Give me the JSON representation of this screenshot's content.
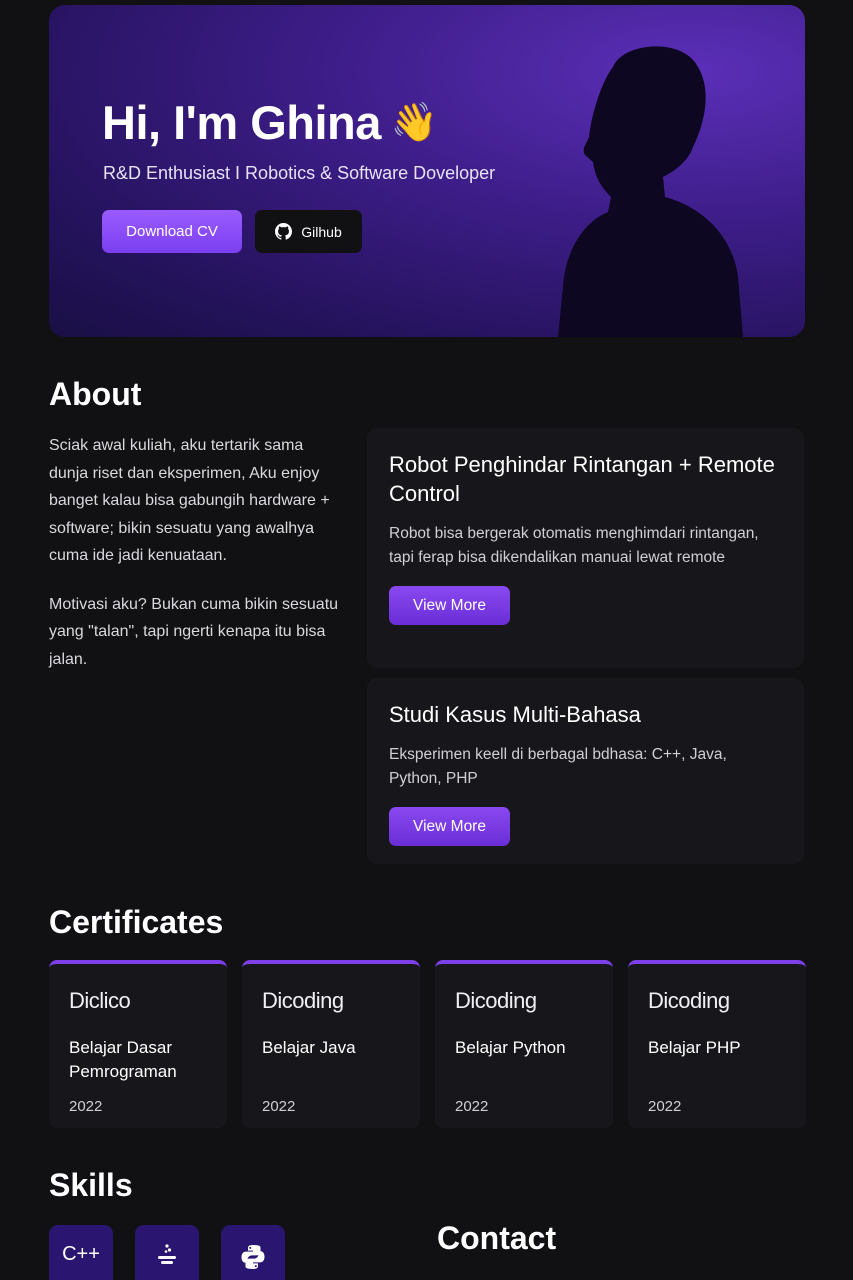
{
  "hero": {
    "greeting": "Hi, I'm Ghina",
    "wave": "👋",
    "subtitle": "R&D Enthusiast I Robotics & Software Doveloper",
    "download_label": "Download CV",
    "github_label": "Gilhub"
  },
  "about": {
    "title": "About",
    "paragraph1": "Sciak awal kuliah, aku tertarik sama dunja riset dan eksperimen, Aku enjoy banget kalau bisa gabungih hardware + software; bikin sesuatu yang awalhya cuma ide jadi kenuataan.",
    "paragraph2": "Motivasi aku? Bukan cuma bikin sesuatu yang \"talan\", tapi ngerti kenapa itu bisa jalan.",
    "projects": [
      {
        "title": "Robot Penghindar Rintangan + Remote Control",
        "desc": "Robot bisa bergerak otomatis menghimdari rintangan, tapi ferap bisa dikendalikan manuai lewat remote",
        "button": "View More"
      },
      {
        "title": "Studi Kasus Multi-Bahasa",
        "desc": "Eksperimen keell di berbagal bdhasa: C++, Java, Python, PHP",
        "button": "View More"
      }
    ]
  },
  "certificates": {
    "title": "Certificates",
    "items": [
      {
        "logo": "Diclico",
        "title": "Belajar Dasar Pemrograman",
        "year": "2022"
      },
      {
        "logo": "Dicoding",
        "title": "Belajar Java",
        "year": "2022"
      },
      {
        "logo": "Dicoding",
        "title": "Belajar Python",
        "year": "2022"
      },
      {
        "logo": "Dicoding",
        "title": "Belajar PHP",
        "year": "2022"
      }
    ]
  },
  "skills": {
    "title": "Skills",
    "items": [
      {
        "label": "C++",
        "icon": "cpp-icon"
      },
      {
        "label": "",
        "icon": "java-icon"
      },
      {
        "label": "",
        "icon": "python-icon"
      }
    ]
  },
  "contact": {
    "title": "Contact"
  }
}
